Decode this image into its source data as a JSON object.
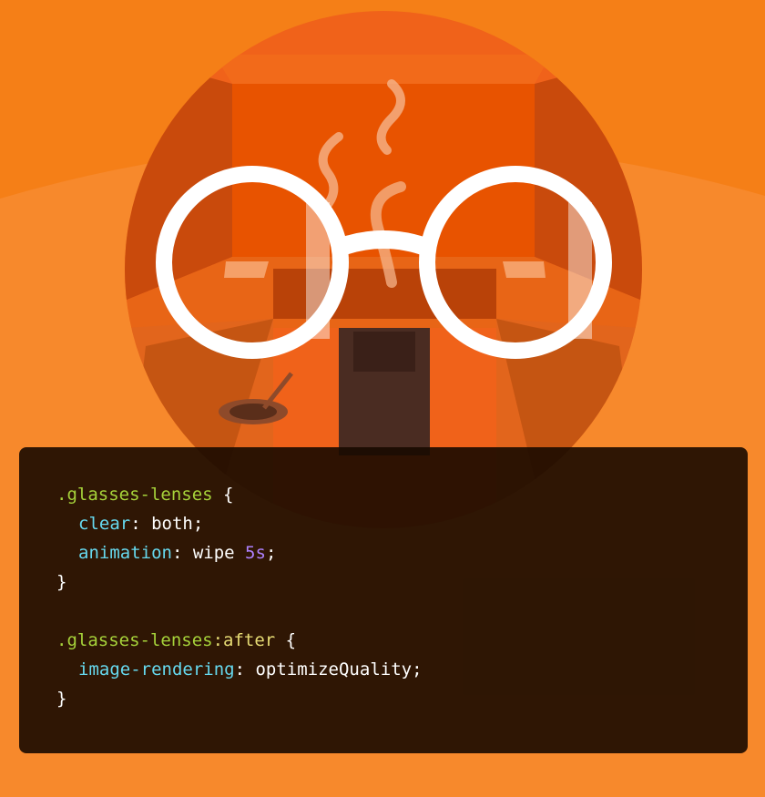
{
  "colors": {
    "background": "#f7892c",
    "top_band": "#f57f17",
    "circle": "#f0621a",
    "code_bg": "#180a00",
    "selector": "#a6d23a",
    "pseudo": "#e6db74",
    "property": "#66d9ef",
    "number": "#ae81ff",
    "text": "#ffffff"
  },
  "illustration": {
    "icon": "hipster-sauna-glasses-icon"
  },
  "code": {
    "rule1": {
      "selector": ".glasses-lenses",
      "open": " {",
      "decl1_prop": "clear",
      "decl1_colon": ": ",
      "decl1_value": "both",
      "decl1_end": ";",
      "decl2_prop": "animation",
      "decl2_colon": ": ",
      "decl2_value": "wipe ",
      "decl2_num": "5s",
      "decl2_end": ";",
      "close": "}"
    },
    "rule2": {
      "selector": ".glasses-lenses",
      "pseudo": ":after",
      "open": " {",
      "decl1_prop": "image-rendering",
      "decl1_colon": ": ",
      "decl1_value": "optimizeQuality",
      "decl1_end": ";",
      "close": "}"
    }
  }
}
